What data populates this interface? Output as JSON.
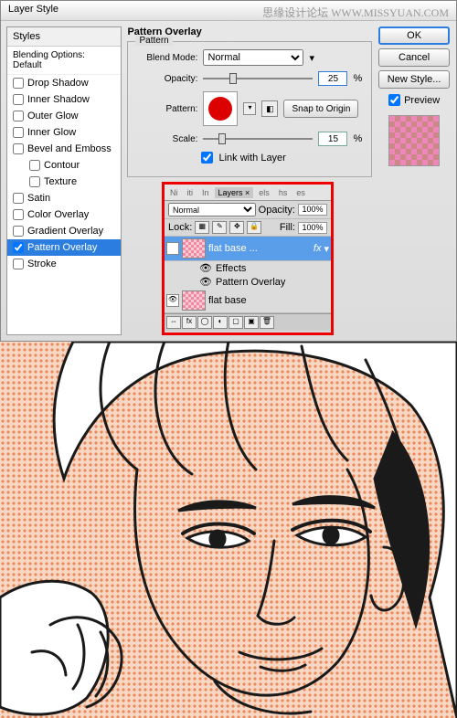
{
  "watermark": "思缘设计论坛  WWW.MISSYUAN.COM",
  "dialog": {
    "title": "Layer Style",
    "styles_header": "Styles",
    "blending_default": "Blending Options: Default",
    "items": [
      {
        "label": "Drop Shadow",
        "checked": false
      },
      {
        "label": "Inner Shadow",
        "checked": false
      },
      {
        "label": "Outer Glow",
        "checked": false
      },
      {
        "label": "Inner Glow",
        "checked": false
      },
      {
        "label": "Bevel and Emboss",
        "checked": false
      },
      {
        "label": "Contour",
        "checked": false,
        "indent": true
      },
      {
        "label": "Texture",
        "checked": false,
        "indent": true
      },
      {
        "label": "Satin",
        "checked": false
      },
      {
        "label": "Color Overlay",
        "checked": false
      },
      {
        "label": "Gradient Overlay",
        "checked": false
      },
      {
        "label": "Pattern Overlay",
        "checked": true,
        "active": true
      },
      {
        "label": "Stroke",
        "checked": false
      }
    ],
    "center": {
      "title": "Pattern Overlay",
      "group": "Pattern",
      "blend_mode_label": "Blend Mode:",
      "blend_mode_value": "Normal",
      "opacity_label": "Opacity:",
      "opacity_value": "25",
      "pattern_label": "Pattern:",
      "snap_btn": "Snap to Origin",
      "scale_label": "Scale:",
      "scale_value": "15",
      "link_label": "Link with Layer",
      "percent": "%"
    },
    "right": {
      "ok": "OK",
      "cancel": "Cancel",
      "new_style": "New Style...",
      "preview": "Preview"
    }
  },
  "layers_panel": {
    "tabs": [
      "Ni",
      "iti",
      "In",
      "Layers ×",
      "els",
      "hs",
      "es"
    ],
    "mode": "Normal",
    "opacity_label": "Opacity:",
    "opacity": "100%",
    "lock_label": "Lock:",
    "fill_label": "Fill:",
    "fill": "100%",
    "layer1": "flat base ...",
    "fx": "fx",
    "effects": "Effects",
    "pattern_overlay": "Pattern Overlay",
    "layer2": "flat base"
  }
}
